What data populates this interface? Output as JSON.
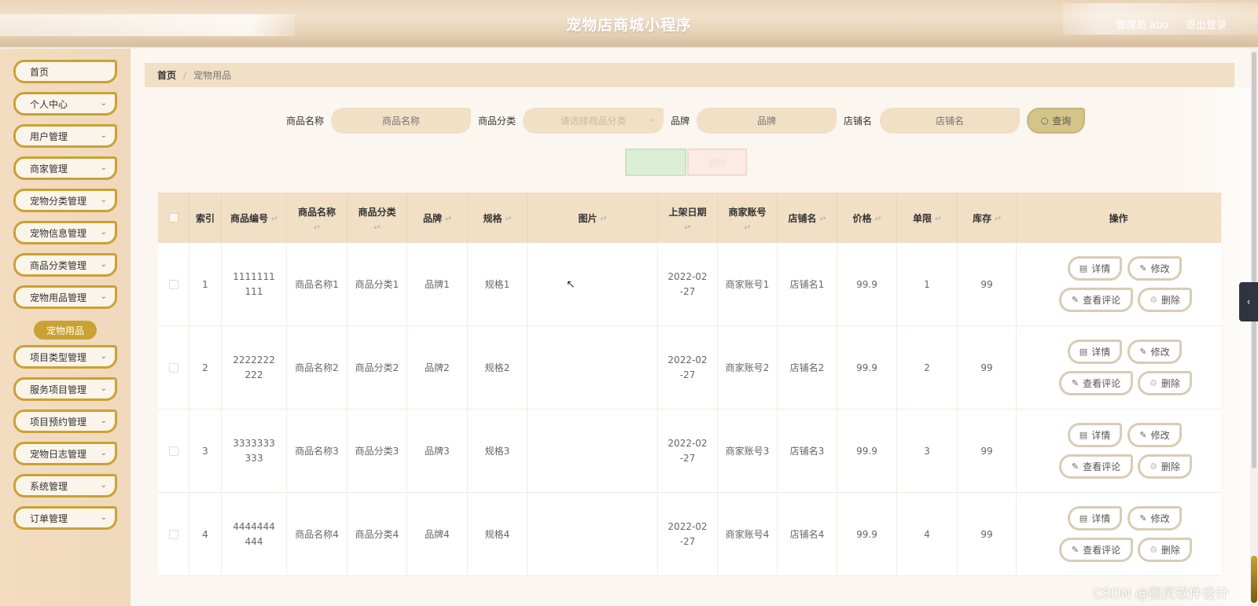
{
  "header": {
    "title": "宠物店商城小程序",
    "user_label": "管理员 abo",
    "logout_label": "退出登录"
  },
  "sidebar": {
    "items": [
      {
        "label": "首页"
      },
      {
        "label": "个人中心"
      },
      {
        "label": "用户管理"
      },
      {
        "label": "商家管理"
      },
      {
        "label": "宠物分类管理"
      },
      {
        "label": "宠物信息管理"
      },
      {
        "label": "商品分类管理"
      },
      {
        "label": "宠物用品管理"
      },
      {
        "label": "项目类型管理"
      },
      {
        "label": "服务项目管理"
      },
      {
        "label": "项目预约管理"
      },
      {
        "label": "宠物日志管理"
      },
      {
        "label": "系统管理"
      },
      {
        "label": "订单管理"
      }
    ],
    "active_submenu": "宠物用品"
  },
  "breadcrumb": {
    "home": "首页",
    "separator": "/",
    "current": "宠物用品"
  },
  "search": {
    "name_label": "商品名称",
    "name_placeholder": "商品名称",
    "category_label": "商品分类",
    "category_placeholder": "请选择商品分类",
    "brand_label": "品牌",
    "brand_placeholder": "品牌",
    "shop_label": "店铺名",
    "shop_placeholder": "店铺名",
    "button_label": "查询"
  },
  "actions": {
    "add_label": "新增",
    "delete_label": "删除"
  },
  "table": {
    "headers": [
      "索引",
      "商品编号",
      "商品名称",
      "商品分类",
      "品牌",
      "规格",
      "图片",
      "上架日期",
      "商家账号",
      "店铺名",
      "价格",
      "单限",
      "库存",
      "操作"
    ],
    "rows": [
      {
        "index": "1",
        "code": "1111111111",
        "name": "商品名称1",
        "category": "商品分类1",
        "brand": "品牌1",
        "spec": "规格1",
        "date": "2022-02-27",
        "merchant": "商家账号1",
        "shop": "店铺名1",
        "price": "99.9",
        "limit": "1",
        "stock": "99"
      },
      {
        "index": "2",
        "code": "2222222222",
        "name": "商品名称2",
        "category": "商品分类2",
        "brand": "品牌2",
        "spec": "规格2",
        "date": "2022-02-27",
        "merchant": "商家账号2",
        "shop": "店铺名2",
        "price": "99.9",
        "limit": "2",
        "stock": "99"
      },
      {
        "index": "3",
        "code": "3333333333",
        "name": "商品名称3",
        "category": "商品分类3",
        "brand": "品牌3",
        "spec": "规格3",
        "date": "2022-02-27",
        "merchant": "商家账号3",
        "shop": "店铺名3",
        "price": "99.9",
        "limit": "3",
        "stock": "99"
      },
      {
        "index": "4",
        "code": "4444444444",
        "name": "商品名称4",
        "category": "商品分类4",
        "brand": "品牌4",
        "spec": "规格4",
        "date": "2022-02-27",
        "merchant": "商家账号4",
        "shop": "店铺名4",
        "price": "99.9",
        "limit": "4",
        "stock": "99"
      }
    ],
    "row_actions": {
      "detail": "详情",
      "edit": "修改",
      "comments": "查看评论",
      "delete": "删除"
    }
  },
  "watermark": "CSDN @图灵软件设计",
  "icons": {
    "search": "search-icon",
    "detail": "document-icon",
    "edit": "pencil-icon",
    "delete": "trash-icon",
    "chevron": "chevron-down-icon",
    "collapse": "chevron-left-icon"
  },
  "colors": {
    "accent": "#c9a233",
    "header_bg": "#e9d3b8",
    "table_head_bg": "#f1dfc6"
  }
}
